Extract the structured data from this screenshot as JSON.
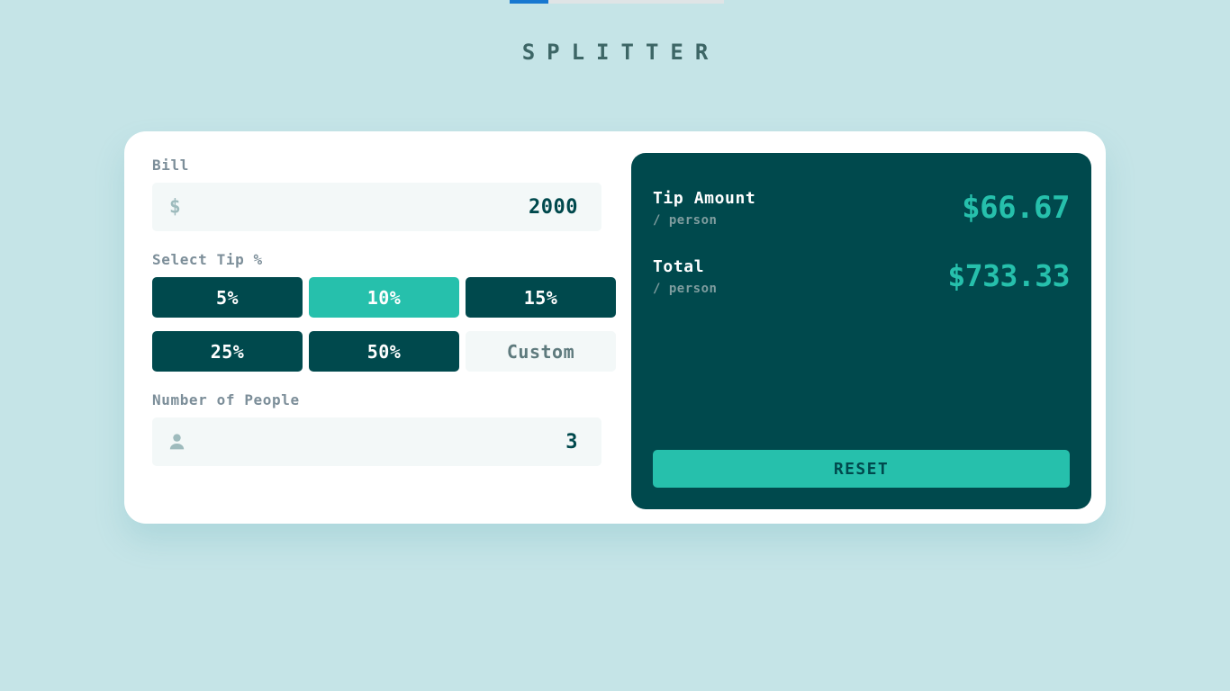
{
  "loading_bar": {
    "name": "page-loading-bar",
    "progress_pct": 18,
    "fill_color": "#1878D0",
    "track_color": "#DFE4E6"
  },
  "app": {
    "title_line1": "SPLITTER",
    "title_line2": "",
    "title_full": "SPLITTER"
  },
  "theme": {
    "background": "#C5E4E7",
    "card": "#FFFFFF",
    "panel_dark": "#00494D",
    "accent": "#26C0AC",
    "input_bg": "#F3F8F8",
    "label_text": "#7C8E99",
    "muted_text": "#7F9D9F"
  },
  "bill": {
    "label": "Bill",
    "icon": "dollar-icon",
    "icon_glyph": "$",
    "value": "2000",
    "placeholder": "0"
  },
  "tip": {
    "label": "Select Tip %",
    "options": [
      {
        "label": "5%",
        "selected": false,
        "custom": false
      },
      {
        "label": "10%",
        "selected": true,
        "custom": false
      },
      {
        "label": "15%",
        "selected": false,
        "custom": false
      },
      {
        "label": "25%",
        "selected": false,
        "custom": false
      },
      {
        "label": "50%",
        "selected": false,
        "custom": false
      },
      {
        "label": "Custom",
        "selected": false,
        "custom": true
      }
    ]
  },
  "people": {
    "label": "Number of People",
    "icon": "person-icon",
    "value": "3",
    "placeholder": "0"
  },
  "results": {
    "tip_amount": {
      "title": "Tip Amount",
      "sub": "/ person",
      "amount": "$66.67"
    },
    "total": {
      "title": "Total",
      "sub": "/ person",
      "amount": "$733.33"
    },
    "reset_label": "RESET"
  }
}
